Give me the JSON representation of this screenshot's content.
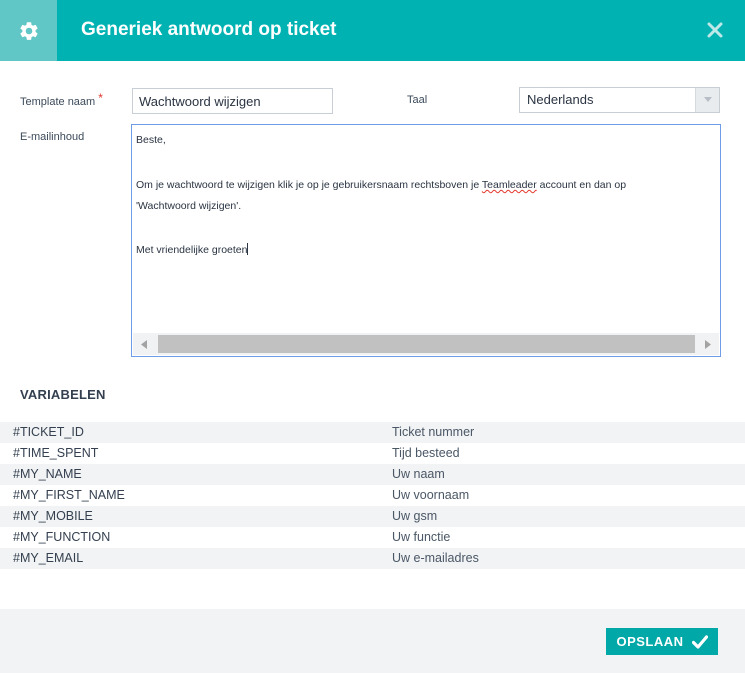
{
  "header": {
    "title": "Generiek antwoord op ticket",
    "settings_icon": "gear-icon",
    "close_icon": "close-icon"
  },
  "form": {
    "template_name_label": "Template naam",
    "required_marker": "*",
    "template_name_value": "Wachtwoord wijzigen",
    "language_label": "Taal",
    "language_value": "Nederlands",
    "email_content_label": "E-mailinhoud"
  },
  "editor": {
    "line1": "Beste,",
    "line2_before": "Om je wachtwoord te wijzigen klik je op je gebruikersnaam rechtsboven je ",
    "line2_spell": "Teamleader",
    "line2_after": " account en dan op",
    "line3": "'Wachtwoord wijzigen'.",
    "line4": "Met vriendelijke groeten"
  },
  "variables": {
    "title": "VARIABELEN",
    "rows": [
      {
        "code": "#TICKET_ID",
        "desc": "Ticket nummer"
      },
      {
        "code": "#TIME_SPENT",
        "desc": "Tijd besteed"
      },
      {
        "code": "#MY_NAME",
        "desc": "Uw naam"
      },
      {
        "code": "#MY_FIRST_NAME",
        "desc": "Uw voornaam"
      },
      {
        "code": "#MY_MOBILE",
        "desc": "Uw gsm"
      },
      {
        "code": "#MY_FUNCTION",
        "desc": "Uw functie"
      },
      {
        "code": "#MY_EMAIL",
        "desc": "Uw e-mailadres"
      }
    ]
  },
  "footer": {
    "save_label": "OPSLAAN",
    "save_icon": "checkmark-icon"
  },
  "colors": {
    "header_bg": "#00b2b2",
    "header_icon_bg": "#61c6c6",
    "save_button": "#00a8a8",
    "required": "#e2362c",
    "editor_border": "#6f9ce8"
  }
}
